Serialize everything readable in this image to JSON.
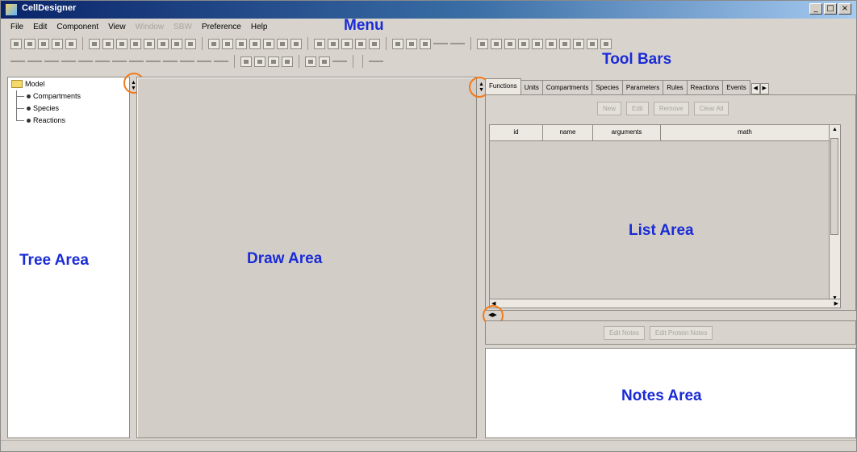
{
  "window": {
    "title": "CellDesigner",
    "buttons": [
      "_",
      "□",
      "×"
    ]
  },
  "menu": {
    "items": [
      {
        "label": "File",
        "enabled": true
      },
      {
        "label": "Edit",
        "enabled": true
      },
      {
        "label": "Component",
        "enabled": true
      },
      {
        "label": "View",
        "enabled": true
      },
      {
        "label": "Window",
        "enabled": false
      },
      {
        "label": "SBW",
        "enabled": false
      },
      {
        "label": "Preference",
        "enabled": true
      },
      {
        "label": "Help",
        "enabled": true
      }
    ]
  },
  "annotations": {
    "menu": "Menu",
    "toolbars": "Tool Bars",
    "tree_area": "Tree Area",
    "draw_area": "Draw Area",
    "list_area": "List Area",
    "notes_area": "Notes Area"
  },
  "tree": {
    "root": "Model",
    "children": [
      "Compartments",
      "Species",
      "Reactions"
    ]
  },
  "tabs": {
    "items": [
      "Functions",
      "Units",
      "Compartments",
      "Species",
      "Parameters",
      "Rules",
      "Reactions",
      "Events"
    ],
    "active": "Functions"
  },
  "list": {
    "buttons": [
      "New",
      "Edit",
      "Remove",
      "Clear All"
    ],
    "columns": [
      "id",
      "name",
      "arguments",
      "math"
    ]
  },
  "notes": {
    "buttons": [
      "Edit Notes",
      "Edit Protein Notes"
    ]
  },
  "colors": {
    "annotation": "#1a2bd6",
    "highlight_circle": "#f27a1a",
    "panel": "#d8d4cd"
  }
}
